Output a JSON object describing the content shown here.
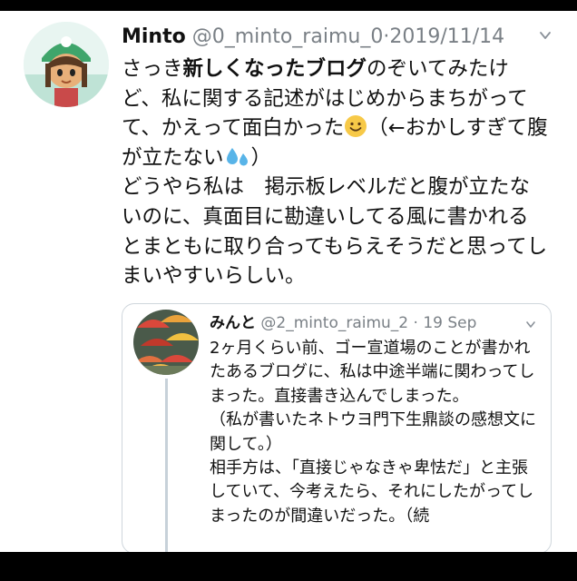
{
  "tweet": {
    "display_name": "Minto",
    "handle": "@0_minto_raimu_0",
    "separator": "·",
    "date": "2019/11/14",
    "text_segments": {
      "p1": "さっき",
      "bold": "新しくなったブログ",
      "p2": "のぞいてみたけど、私に関する記述がはじめからまちがってて、かえって面白かった",
      "p3": "（←おかしすぎて腹が立たない",
      "p4": "）",
      "p5": "どうやら私は　掲示板レベルだと腹が立たないのに、真面目に勘違いしてる風に書かれるとまともに取り合ってもらえそうだと思ってしまいやすいらしい。"
    },
    "emoji1": "smiling-face-emoji",
    "emoji2": "sweat-droplets-emoji"
  },
  "quoted": {
    "display_name": "みんと",
    "handle": "@2_minto_raimu_2",
    "separator": "·",
    "date": "19 Sep",
    "text": "2ヶ月くらい前、ゴー宣道場のことが書かれたあるブログに、私は中途半端に関わってしまった。直接書き込んでしまった。\n（私が書いたネトウヨ門下生鼎談の感想文に関して。）\n相手方は、「直接じゃなきゃ卑怯だ」と主張していて、今考えたら、それにしたがってしまったのが間違いだった。（続"
  }
}
